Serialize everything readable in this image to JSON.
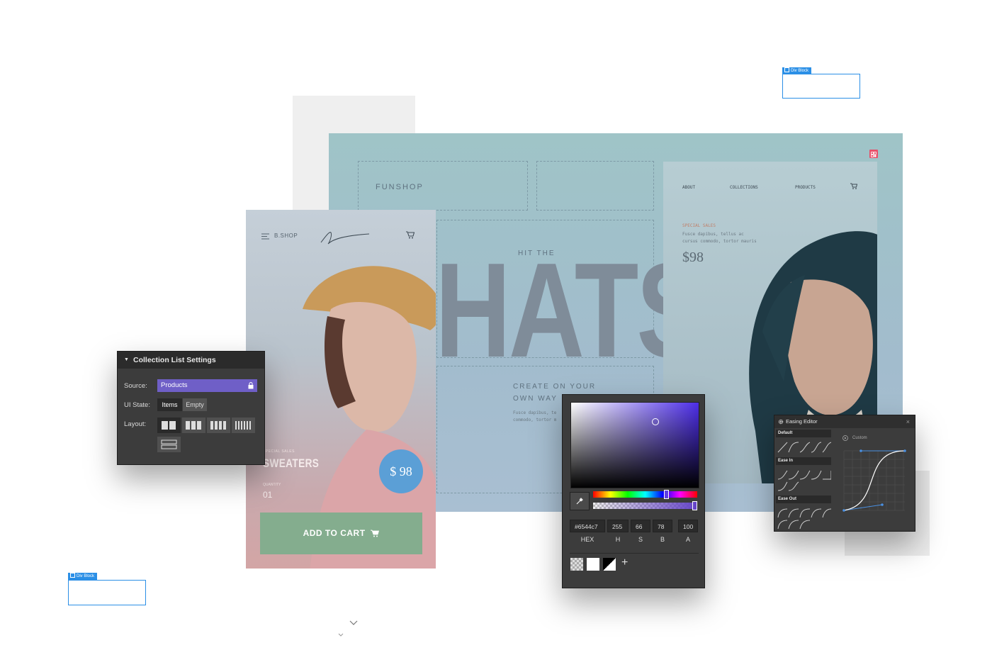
{
  "canvas": {
    "div_block_top_label": "Div Block",
    "div_block_bottom_label": "Div Block"
  },
  "desktop": {
    "brand": "FUNSHOP",
    "hit_the": "HIT THE",
    "headline": "HATS",
    "create_line1": "CREATE ON YOUR",
    "create_line2": "OWN WAY",
    "body_line1": "Fusce dapibus, te",
    "body_line2": "commodo, tortor m",
    "nav": [
      "ABOUT",
      "COLLECTIONS",
      "PRODUCTS"
    ],
    "special_sales": "SPECIAL SALES",
    "special_line1": "Fusce dapibus, tellus ac",
    "special_line2": "cursus commodo, tortor mauris",
    "price": "$98",
    "accent_color": "#e8506a"
  },
  "phone": {
    "brand": "B.SHOP",
    "small_label": "SPECIAL SALES",
    "product_name": "SWEATERS",
    "quantity_label": "QUANTITY",
    "quantity_value": "01",
    "price": "$ 98",
    "add_to_cart": "ADD TO CART",
    "button_color": "#84ad8e",
    "price_badge_color": "#5b9fd6"
  },
  "collection_settings": {
    "title": "Collection List Settings",
    "source_label": "Source:",
    "source_value": "Products",
    "ui_state_label": "UI State:",
    "ui_state_options": [
      "Items",
      "Empty"
    ],
    "layout_label": "Layout:",
    "source_color": "#6f5fc7"
  },
  "color_picker": {
    "hex_value": "#6544c7",
    "h_value": "255",
    "s_value": "66",
    "b_value": "78",
    "a_value": "100",
    "labels": [
      "HEX",
      "H",
      "S",
      "B",
      "A"
    ],
    "add_symbol": "+"
  },
  "easing_editor": {
    "title": "Easing Editor",
    "sections": [
      "Default",
      "Ease In",
      "Ease Out"
    ],
    "custom_label": "Custom",
    "curve_color": "#4a90e2"
  }
}
